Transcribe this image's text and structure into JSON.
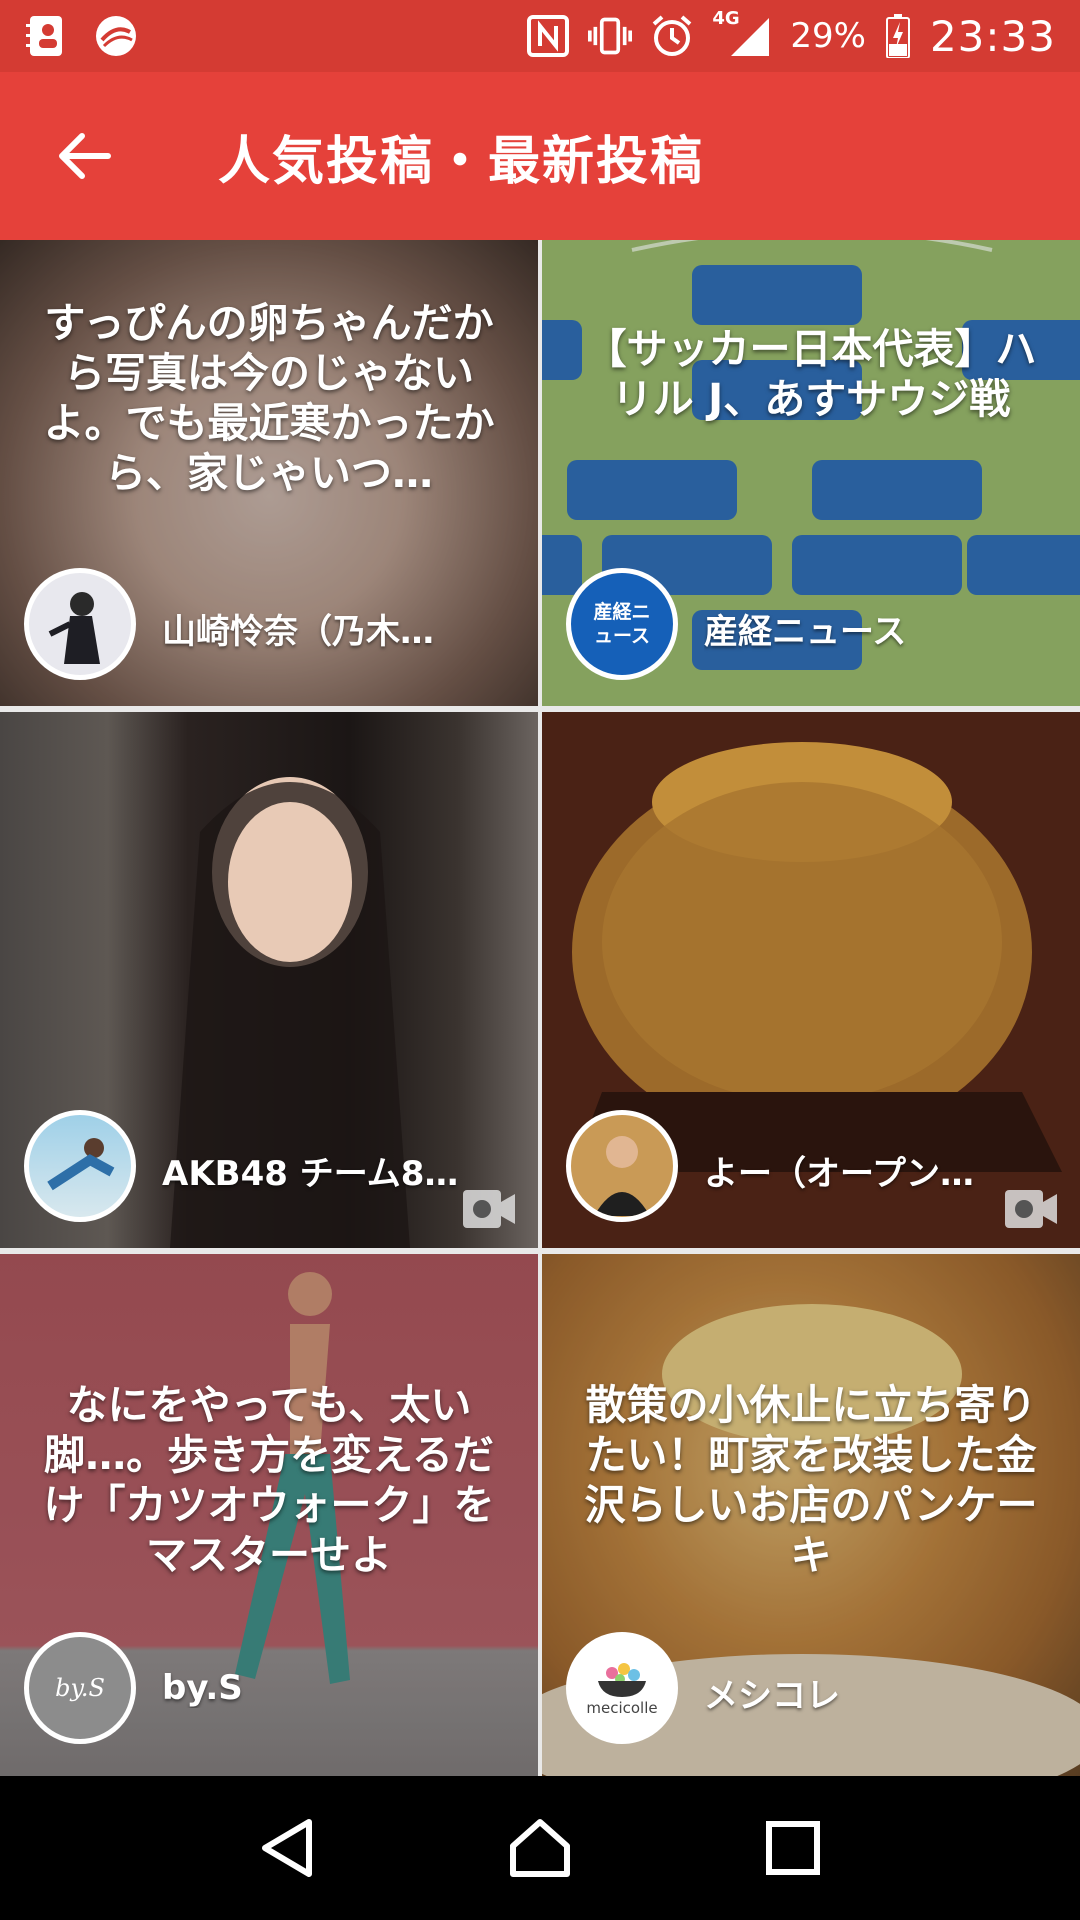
{
  "status_bar": {
    "network": "4G",
    "battery_percent": "29%",
    "time": "23:33",
    "icons": [
      "contacts-icon",
      "browser-security-icon",
      "nfc-icon",
      "vibrate-icon",
      "alarm-icon",
      "signal-icon",
      "battery-icon"
    ]
  },
  "app_bar": {
    "title": "人気投稿・最新投稿",
    "back_icon": "arrow-left-icon"
  },
  "tiles": [
    {
      "text": "すっぴんの卵ちゃんだから写真は今のじゃないよ。でも最近寒かったから、家じゃいつ…",
      "author": "山崎怜奈（乃木…",
      "has_video": false
    },
    {
      "text": "【サッカー日本代表】ハリル J、あすサウジ戦",
      "author": "産経ニュース",
      "avatar_label": "産経ニュース",
      "has_video": false
    },
    {
      "text": "",
      "author": "AKB48 チーム8 …",
      "has_video": true
    },
    {
      "text": "",
      "author": "よー（オープン…",
      "has_video": true
    },
    {
      "text": "なにをやっても、太い脚…。歩き方を変えるだけ「カツオウォーク」をマスターせよ",
      "author": "by.S",
      "avatar_label": "by.S",
      "has_video": false
    },
    {
      "text": "散策の小休止に立ち寄りたい！町家を改装した金沢らしいお店のパンケーキ",
      "author": "メシコレ",
      "avatar_label": "mecicolle",
      "has_video": false
    }
  ],
  "colors": {
    "status_bar": "#d43b33",
    "app_bar": "#e5413a",
    "nav_bar": "#000000"
  }
}
